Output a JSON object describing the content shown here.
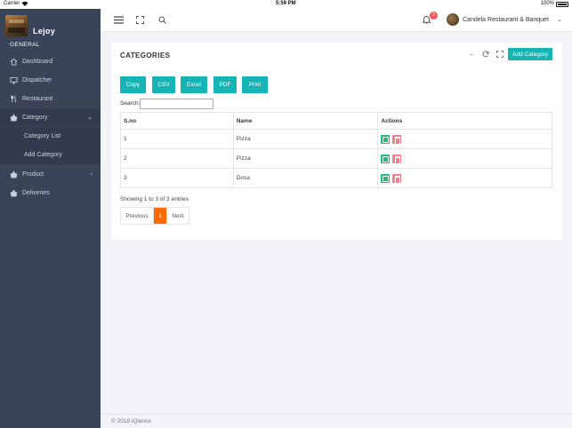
{
  "status_bar": {
    "carrier": "Carrier",
    "time": "5:59 PM",
    "battery": "100%"
  },
  "brand": {
    "name": "Lejoy"
  },
  "sidebar": {
    "section": "GENERAL",
    "items": [
      {
        "label": "Dashboard",
        "icon": "home-icon"
      },
      {
        "label": "Dispatcher",
        "icon": "monitor-icon"
      },
      {
        "label": "Restaurant",
        "icon": "cutlery-icon"
      },
      {
        "label": "Category",
        "icon": "basket-icon"
      },
      {
        "label": "Product",
        "icon": "basket-icon"
      },
      {
        "label": "Deliveries",
        "icon": "basket-icon"
      }
    ],
    "sub_items": [
      {
        "label": "Category List"
      },
      {
        "label": "Add Category"
      }
    ]
  },
  "header": {
    "notification_count": "2",
    "user_name": "Candela Restaurant & Banquet"
  },
  "card": {
    "title": "CATEGORIES",
    "add_label": "Add Category",
    "export_buttons": [
      "Copy",
      "CSV",
      "Excel",
      "PDF",
      "Print"
    ],
    "search_label": "Search:",
    "search_value": ""
  },
  "table": {
    "headers": [
      "S.no",
      "Name",
      "Actions"
    ],
    "rows": [
      {
        "sno": "1",
        "name": "Pizza"
      },
      {
        "sno": "2",
        "name": "Pizza"
      },
      {
        "sno": "3",
        "name": "Dosa"
      }
    ]
  },
  "pagination": {
    "info": "Showing 1 to 3 of 3 entries",
    "prev": "Previous",
    "current": "1",
    "next": "Next"
  },
  "footer": {
    "text": "© 2018 iQlance"
  },
  "colors": {
    "sidebar": "#3a4459",
    "accent": "#16b4b4",
    "page_active": "#ff6a00",
    "edit": "#1fbf7a",
    "delete": "#f07f8a",
    "badge": "#f05a5a"
  }
}
